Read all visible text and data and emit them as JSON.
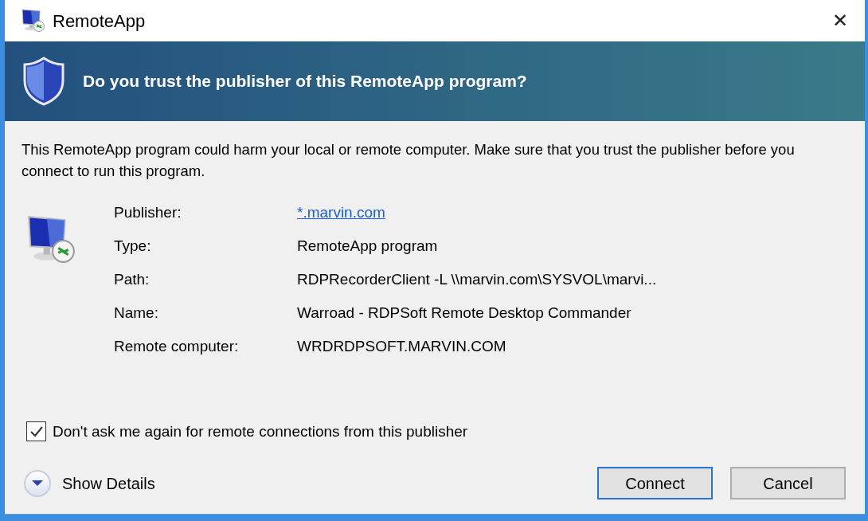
{
  "window": {
    "title": "RemoteApp",
    "close": "✕"
  },
  "banner": {
    "heading": "Do you trust the publisher of this RemoteApp program?"
  },
  "message": "This RemoteApp program could harm your local or remote computer. Make sure that you trust the publisher before you connect to run this program.",
  "details": [
    {
      "label": "Publisher:",
      "value": "*.marvin.com",
      "kind": "link"
    },
    {
      "label": "Type:",
      "value": "RemoteApp program",
      "kind": "text"
    },
    {
      "label": "Path:",
      "value": "RDPRecorderClient -L \\\\marvin.com\\SYSVOL\\marvi...",
      "kind": "text"
    },
    {
      "label": "Name:",
      "value": "Warroad - RDPSoft Remote Desktop Commander",
      "kind": "text"
    },
    {
      "label": "Remote computer:",
      "value": "WRDRDPSOFT.MARVIN.COM",
      "kind": "text"
    }
  ],
  "dont_ask": {
    "label": "Don't ask me again for remote connections from this publisher",
    "checked": true
  },
  "show_details": {
    "label": "Show Details",
    "expanded": false
  },
  "buttons": [
    {
      "label": "Connect",
      "default": true
    },
    {
      "label": "Cancel",
      "default": false
    }
  ]
}
